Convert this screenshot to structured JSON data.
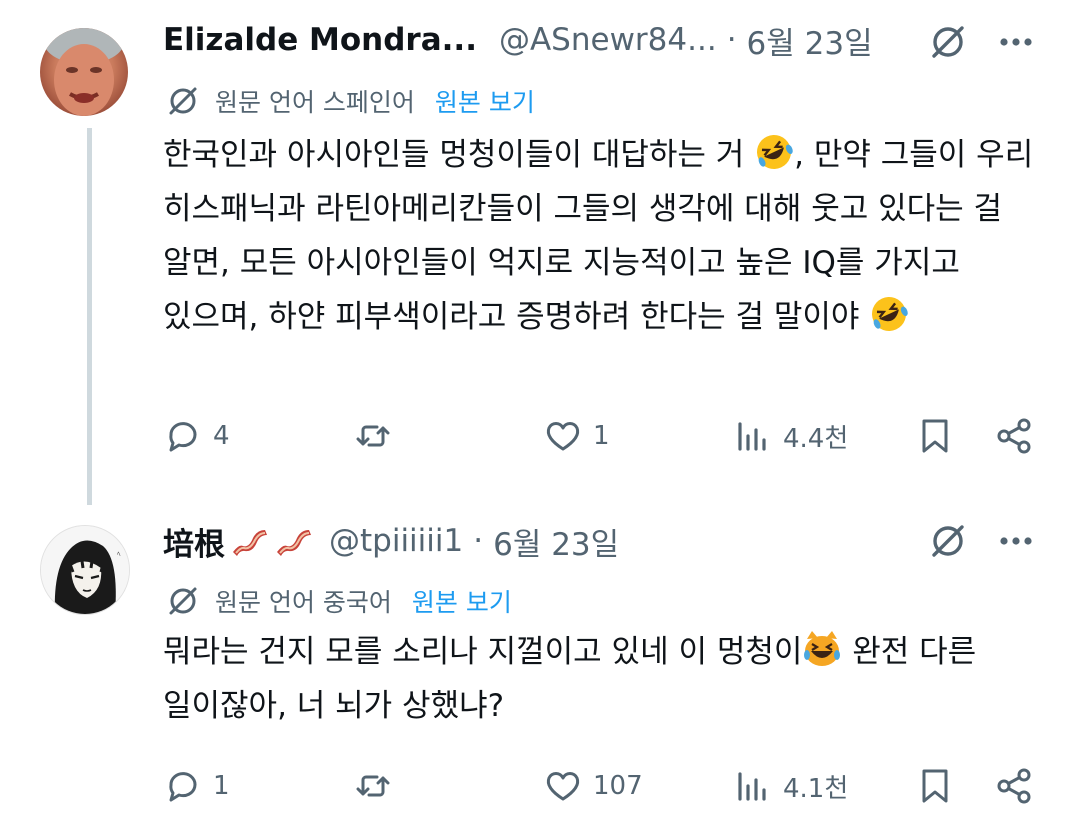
{
  "tweets": [
    {
      "name": "Elizalde Mondra...",
      "handle": "@ASnewr84...",
      "date": "6월 23일",
      "translate_note": "원문 언어 스페인어",
      "show_original": "원본 보기",
      "text_part1": "한국인과 아시아인들 멍청이들이 대답하는 거 ",
      "text_part2": ", 만약 그들이 우리 히스패닉과 라틴아메리칸들이 그들의 생각에 대해 웃고 있다는 걸 알면, 모든 아시아인들이 억지로 지능적이고 높은 IQ를 가지고 있으며, 하얀 피부색이라고 증명하려 한다는 걸 말이야 ",
      "replies": "4",
      "retweets": "",
      "likes": "1",
      "views": "4.4천"
    },
    {
      "name": "培根",
      "handle": "@tpiiiiii1",
      "date": "6월 23일",
      "translate_note": "원문 언어 중국어",
      "show_original": "원본 보기",
      "text_part1": "뭐라는 건지 모를 소리나 지껄이고 있네 이 멍청이",
      "text_part2": " 완전 다른 일이잖아, 너 뇌가 상했냐?",
      "replies": "1",
      "retweets": "",
      "likes": "107",
      "views": "4.1천"
    }
  ],
  "icons": {
    "grok": "grok-icon",
    "more": "more-icon",
    "translate": "translate-icon",
    "reply": "reply-icon",
    "retweet": "retweet-icon",
    "like": "heart-icon",
    "views": "views-icon",
    "bookmark": "bookmark-icon",
    "share": "share-icon"
  },
  "colors": {
    "text": "#0f1419",
    "muted": "#536471",
    "link": "#1d9bf0",
    "thread": "#cfd9de"
  }
}
